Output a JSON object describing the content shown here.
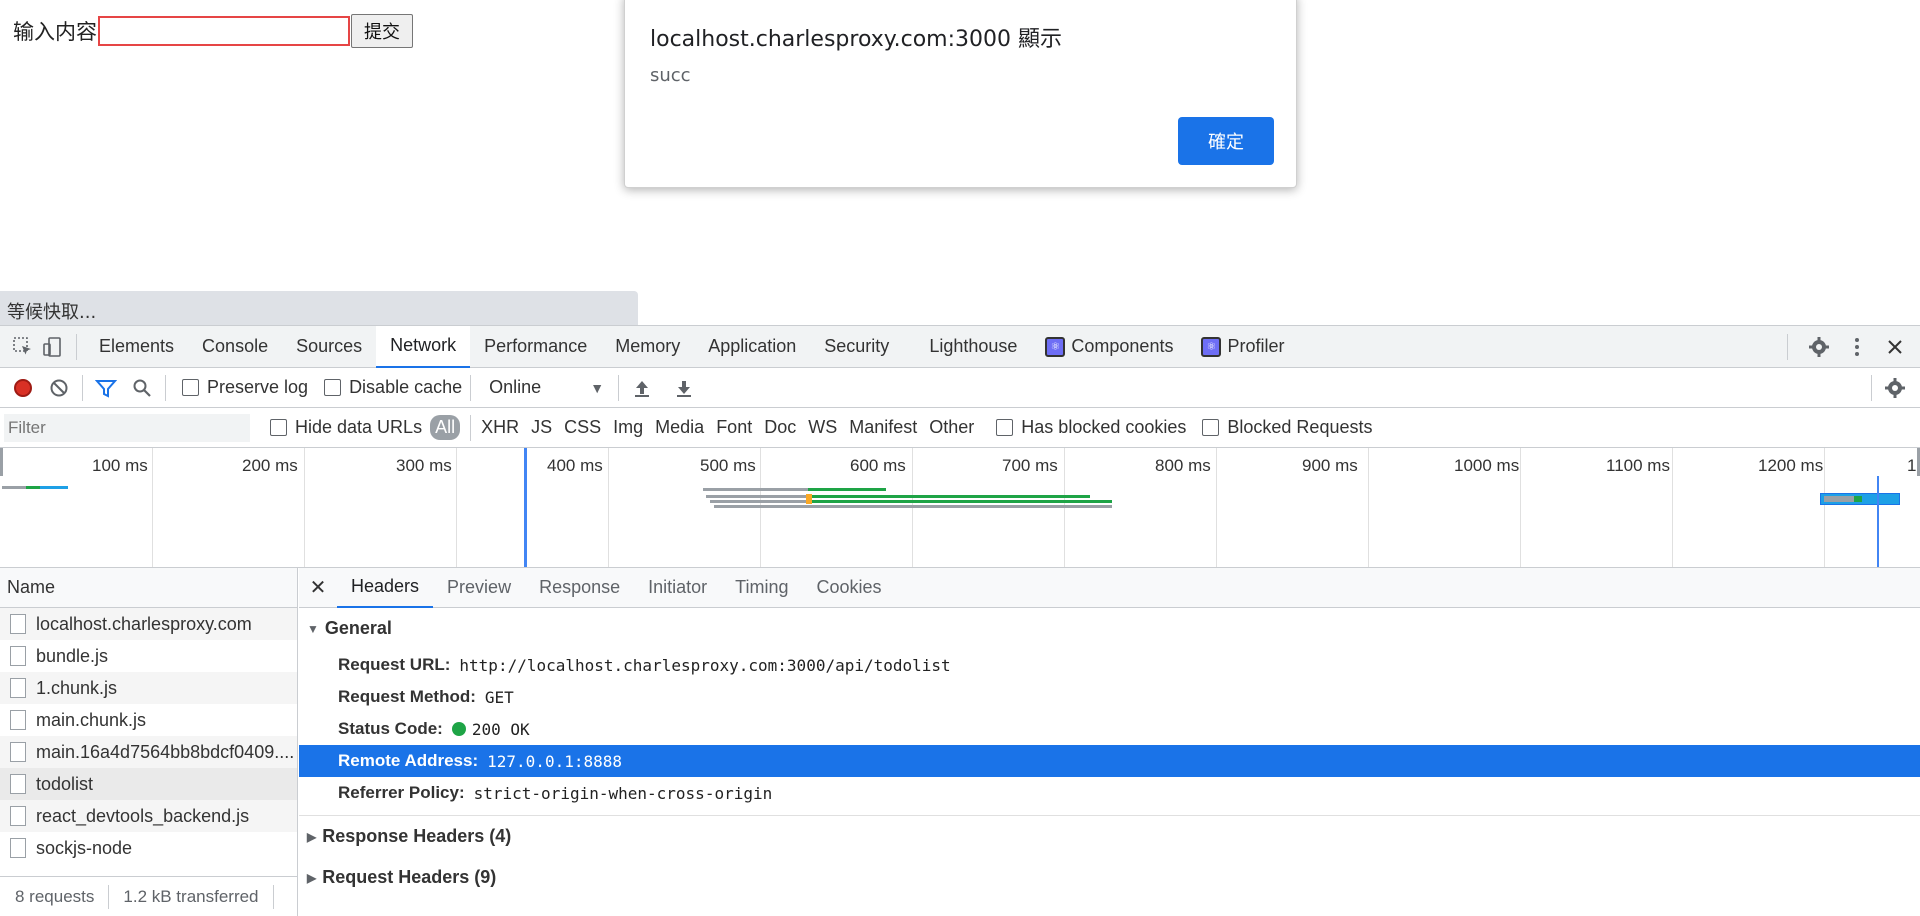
{
  "page": {
    "form_label": "输入内容",
    "submit_label": "提交",
    "status_text": "等候快取..."
  },
  "dialog": {
    "title": "localhost.charlesproxy.com:3000 顯示",
    "message": "succ",
    "ok_label": "確定"
  },
  "devtools": {
    "tabs": [
      "Elements",
      "Console",
      "Sources",
      "Network",
      "Performance",
      "Memory",
      "Application",
      "Security",
      "Lighthouse",
      "Components",
      "Profiler"
    ],
    "active_tab": "Network",
    "toolbar": {
      "preserve_log": "Preserve log",
      "disable_cache": "Disable cache",
      "throttle": "Online"
    },
    "filter": {
      "placeholder": "Filter",
      "hide_data_urls": "Hide data URLs",
      "types": [
        "All",
        "XHR",
        "JS",
        "CSS",
        "Img",
        "Media",
        "Font",
        "Doc",
        "WS",
        "Manifest",
        "Other"
      ],
      "has_blocked_cookies": "Has blocked cookies",
      "blocked_requests": "Blocked Requests"
    },
    "overview": {
      "ticks": [
        "100 ms",
        "200 ms",
        "300 ms",
        "400 ms",
        "500 ms",
        "600 ms",
        "700 ms",
        "800 ms",
        "900 ms",
        "1000 ms",
        "1100 ms",
        "1200 ms",
        "1"
      ]
    },
    "name_header": "Name",
    "requests": [
      "localhost.charlesproxy.com",
      "bundle.js",
      "1.chunk.js",
      "main.chunk.js",
      "main.16a4d7564bb8bdcf0409....",
      "todolist",
      "react_devtools_backend.js",
      "sockjs-node"
    ],
    "summary": {
      "requests": "8 requests",
      "transferred": "1.2 kB transferred"
    },
    "detail_tabs": [
      "Headers",
      "Preview",
      "Response",
      "Initiator",
      "Timing",
      "Cookies"
    ],
    "general": {
      "title": "General",
      "request_url_k": "Request URL:",
      "request_url_v": "http://localhost.charlesproxy.com:3000/api/todolist",
      "method_k": "Request Method:",
      "method_v": "GET",
      "status_k": "Status Code:",
      "status_v": "200 OK",
      "remote_k": "Remote Address:",
      "remote_v": "127.0.0.1:8888",
      "referrer_k": "Referrer Policy:",
      "referrer_v": "strict-origin-when-cross-origin"
    },
    "response_headers": "Response Headers (4)",
    "request_headers": "Request Headers (9)"
  }
}
